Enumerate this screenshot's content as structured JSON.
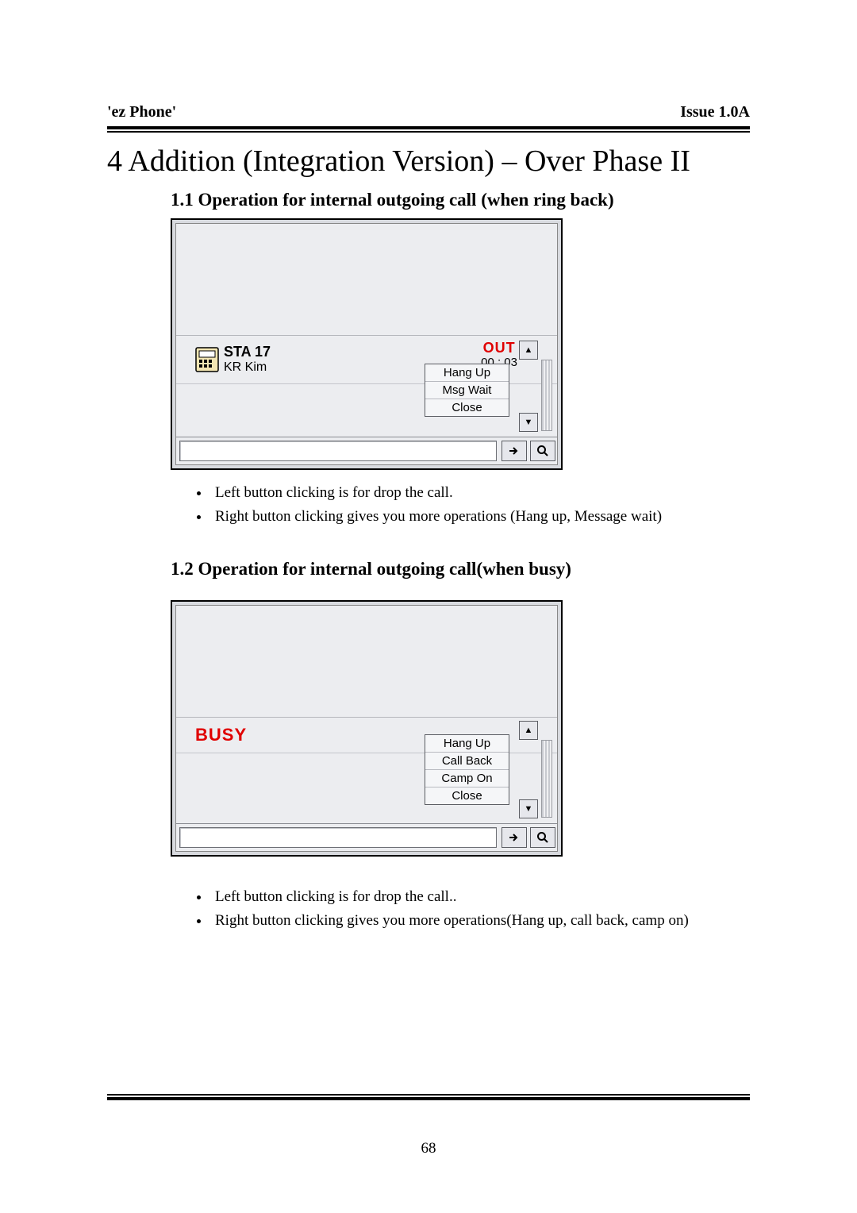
{
  "header": {
    "left": "'ez Phone'",
    "right": "Issue 1.0A"
  },
  "title": "4  Addition (Integration Version) – Over Phase II",
  "sections": {
    "s1": {
      "heading": "1.1 Operation for internal outgoing call (when ring back)",
      "panel": {
        "station_label": "STA 17",
        "station_name": "KR Kim",
        "out_label": "OUT",
        "out_time": "00 : 03",
        "menu": [
          "Hang Up",
          "Msg Wait",
          "Close"
        ]
      },
      "bullets": [
        "Left button clicking is for drop the call.",
        "Right button clicking gives you more operations (Hang up, Message wait)"
      ]
    },
    "s2": {
      "heading": "1.2 Operation for internal outgoing call(when busy)",
      "panel": {
        "busy_label": "BUSY",
        "menu": [
          "Hang Up",
          "Call Back",
          "Camp On",
          "Close"
        ]
      },
      "bullets": [
        "Left button clicking is for drop the call..",
        "Right button clicking gives you more operations(Hang up, call back, camp on)"
      ]
    }
  },
  "page_number": "68"
}
